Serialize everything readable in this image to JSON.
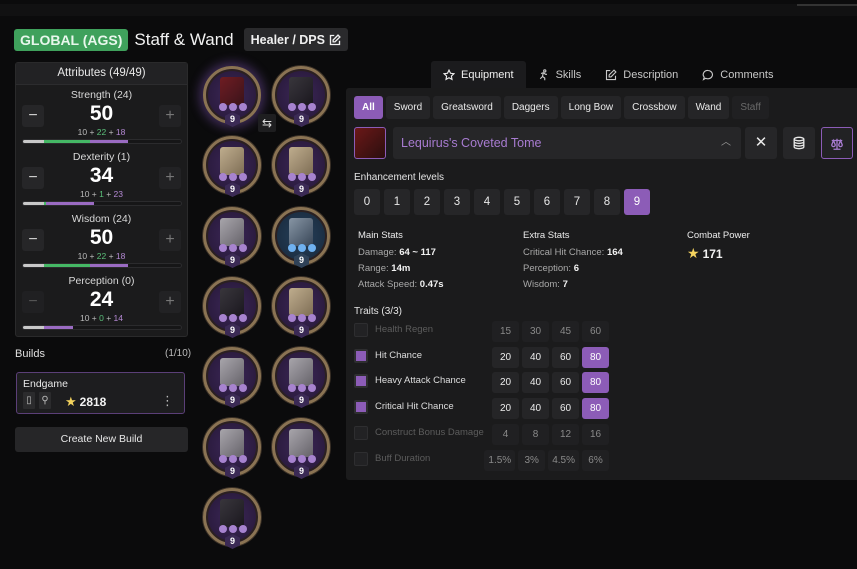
{
  "header": {
    "region": "GLOBAL (AGS)",
    "title": "Staff & Wand",
    "role": "Healer / DPS",
    "role_icon": "edit-icon"
  },
  "attributes": {
    "title": "Attributes (49/49)",
    "items": [
      {
        "name": "Strength (24)",
        "value": "50",
        "base": "10",
        "bonus_green": "22",
        "bonus_purple": "18",
        "bar": {
          "base_pct": 0.1,
          "green_pct": 0.22,
          "purple_pct": 0.18
        },
        "minus_enabled": true
      },
      {
        "name": "Dexterity (1)",
        "value": "34",
        "base": "10",
        "bonus_green": "1",
        "bonus_purple": "23",
        "bar": {
          "base_pct": 0.1,
          "green_pct": 0.01,
          "purple_pct": 0.23
        },
        "minus_enabled": true
      },
      {
        "name": "Wisdom (24)",
        "value": "50",
        "base": "10",
        "bonus_green": "22",
        "bonus_purple": "18",
        "bar": {
          "base_pct": 0.1,
          "green_pct": 0.22,
          "purple_pct": 0.18
        },
        "minus_enabled": true
      },
      {
        "name": "Perception (0)",
        "value": "24",
        "base": "10",
        "bonus_green": "0",
        "bonus_purple": "14",
        "bar": {
          "base_pct": 0.1,
          "green_pct": 0.0,
          "purple_pct": 0.14
        },
        "minus_enabled": false
      }
    ],
    "minus_label": "−",
    "plus_label": "+",
    "plus_sep": "+"
  },
  "builds": {
    "label": "Builds",
    "count": "(1/10)",
    "items": [
      {
        "name": "Endgame",
        "combat_power": "2818",
        "menu_icon": "⋮"
      }
    ],
    "create_label": "Create New Build"
  },
  "gear": {
    "slots": [
      {
        "slot": "main-weapon",
        "level": "9",
        "style": "weapon",
        "dots": "purple",
        "active": true
      },
      {
        "slot": "head",
        "level": "9",
        "style": "dark",
        "dots": "purple"
      },
      {
        "slot": "cloak",
        "level": "9",
        "style": "gold",
        "dots": "purple"
      },
      {
        "slot": "chest-robe",
        "level": "9",
        "style": "gold",
        "dots": "purple"
      },
      {
        "slot": "chest",
        "level": "9",
        "style": "",
        "dots": "purple"
      },
      {
        "slot": "gloves",
        "level": "9",
        "style": "blue",
        "dots": "blue",
        "blueish": true
      },
      {
        "slot": "pants",
        "level": "9",
        "style": "dark",
        "dots": "purple"
      },
      {
        "slot": "boots",
        "level": "9",
        "style": "gold",
        "dots": "purple"
      },
      {
        "slot": "belt",
        "level": "9",
        "style": "",
        "dots": "purple"
      },
      {
        "slot": "bracelet",
        "level": "9",
        "style": "",
        "dots": "purple"
      },
      {
        "slot": "ring-1",
        "level": "9",
        "style": "",
        "dots": "purple"
      },
      {
        "slot": "ring-2",
        "level": "9",
        "style": "",
        "dots": "purple"
      },
      {
        "slot": "artifact",
        "level": "9",
        "style": "dark",
        "dots": "purple"
      }
    ],
    "swap_icon": "⇆"
  },
  "tabs": [
    {
      "label": "Equipment",
      "icon": "star-outline-icon",
      "active": true
    },
    {
      "label": "Skills",
      "icon": "running-figure-icon"
    },
    {
      "label": "Description",
      "icon": "edit-icon"
    },
    {
      "label": "Comments",
      "icon": "speech-bubble-icon"
    }
  ],
  "equipment": {
    "filters": [
      {
        "label": "All",
        "active": true
      },
      {
        "label": "Sword"
      },
      {
        "label": "Greatsword"
      },
      {
        "label": "Daggers"
      },
      {
        "label": "Long Bow"
      },
      {
        "label": "Crossbow"
      },
      {
        "label": "Wand"
      },
      {
        "label": "Staff",
        "dim": true
      }
    ],
    "selected_item": "Lequirus's Coveted Tome",
    "clear_icon": "✕",
    "enhancement_label": "Enhancement levels",
    "enhancement_levels": [
      "0",
      "1",
      "2",
      "3",
      "4",
      "5",
      "6",
      "7",
      "8",
      "9"
    ],
    "enhancement_selected": "9",
    "main_stats": {
      "title": "Main Stats",
      "lines": [
        {
          "label": "Damage: ",
          "value": "64 ~ 117"
        },
        {
          "label": "Range: ",
          "value": "14m"
        },
        {
          "label": "Attack Speed: ",
          "value": "0.47s"
        }
      ]
    },
    "extra_stats": {
      "title": "Extra Stats",
      "lines": [
        {
          "label": "Critical Hit Chance: ",
          "value": "164"
        },
        {
          "label": "Perception: ",
          "value": "6"
        },
        {
          "label": "Wisdom: ",
          "value": "7"
        }
      ]
    },
    "combat_power": {
      "title": "Combat Power",
      "value": "171"
    },
    "traits": {
      "title": "Traits (3/3)",
      "items": [
        {
          "name": "Health Regen",
          "checked": false,
          "values": [
            "15",
            "30",
            "45",
            "60"
          ],
          "selected": null
        },
        {
          "name": "Hit Chance",
          "checked": true,
          "values": [
            "20",
            "40",
            "60",
            "80"
          ],
          "selected": "80"
        },
        {
          "name": "Heavy Attack Chance",
          "checked": true,
          "values": [
            "20",
            "40",
            "60",
            "80"
          ],
          "selected": "80"
        },
        {
          "name": "Critical Hit Chance",
          "checked": true,
          "values": [
            "20",
            "40",
            "60",
            "80"
          ],
          "selected": "80"
        },
        {
          "name": "Construct Bonus Damage",
          "checked": false,
          "values": [
            "4",
            "8",
            "12",
            "16"
          ],
          "selected": null
        },
        {
          "name": "Buff Duration",
          "checked": false,
          "values": [
            "1.5%",
            "3%",
            "4.5%",
            "6%"
          ],
          "selected": null
        }
      ]
    }
  },
  "colors": {
    "accent": "#8c5cb7",
    "region_badge": "#3fa15c",
    "bonus_green": "#45b865",
    "bonus_purple": "#9a6bc2",
    "star": "#f4d35e"
  }
}
